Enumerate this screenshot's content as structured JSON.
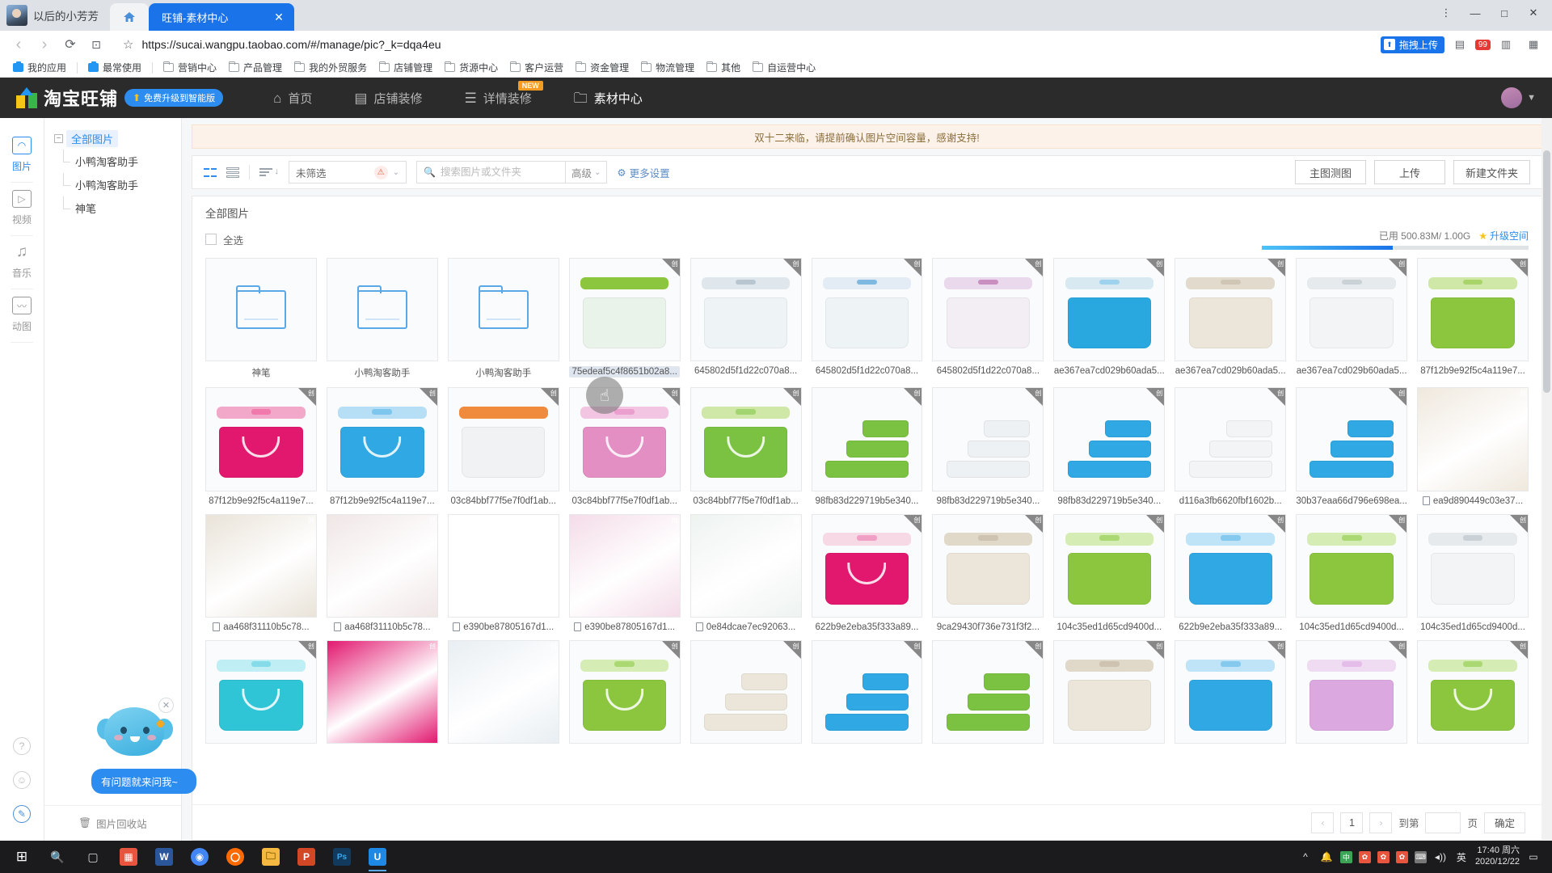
{
  "browser": {
    "profile_name": "以后的小芳芳",
    "tab_title": "旺铺-素材中心",
    "tab_close": "✕",
    "url": "https://sucai.wangpu.taobao.com/#/manage/pic?_k=dqa4eu",
    "nav": {
      "back": "‹",
      "forward": "›",
      "reload": "⟳",
      "cast": "⊡",
      "star": "☆"
    },
    "window": {
      "minimize": "—",
      "maximize": "□",
      "close": "✕",
      "menu": "⋮"
    },
    "ext_chip_label": "拖拽上传",
    "ext_badge": "99",
    "bookmarks": [
      {
        "label": "我的应用",
        "icon": "app-icon"
      },
      {
        "label": "最常使用",
        "icon": "app-icon"
      },
      {
        "label": "营销中心",
        "icon": "folder-icon"
      },
      {
        "label": "产品管理",
        "icon": "folder-icon"
      },
      {
        "label": "我的外贸服务",
        "icon": "folder-icon"
      },
      {
        "label": "店铺管理",
        "icon": "folder-icon"
      },
      {
        "label": "货源中心",
        "icon": "folder-icon"
      },
      {
        "label": "客户运营",
        "icon": "folder-icon"
      },
      {
        "label": "资金管理",
        "icon": "folder-icon"
      },
      {
        "label": "物流管理",
        "icon": "folder-icon"
      },
      {
        "label": "其他",
        "icon": "folder-icon"
      },
      {
        "label": "自运营中心",
        "icon": "folder-icon"
      }
    ]
  },
  "app_header": {
    "logo_text": "淘宝旺铺",
    "upgrade_pill": "免费升级到智能版",
    "nav": [
      {
        "label": "首页",
        "icon": "home-icon",
        "active": false,
        "badge": ""
      },
      {
        "label": "店铺装修",
        "icon": "shop-icon",
        "active": false,
        "badge": ""
      },
      {
        "label": "详情装修",
        "icon": "detail-icon",
        "active": false,
        "badge": "NEW"
      },
      {
        "label": "素材中心",
        "icon": "material-icon",
        "active": true,
        "badge": ""
      }
    ]
  },
  "rail": {
    "items": [
      {
        "label": "图片",
        "icon": "image-icon",
        "active": true
      },
      {
        "label": "视频",
        "icon": "video-icon",
        "active": false
      },
      {
        "label": "音乐",
        "icon": "music-icon",
        "active": false
      },
      {
        "label": "动图",
        "icon": "gif-icon",
        "active": false
      }
    ],
    "help": "?",
    "feedback": "☺",
    "edit": "✎"
  },
  "tree": {
    "toggle": "−",
    "root": "全部图片",
    "children": [
      "小鸭淘客助手",
      "小鸭淘客助手",
      "神笔"
    ],
    "recycle_bin": "图片回收站"
  },
  "notice": "双十二来临，请提前确认图片空间容量，感谢支持!",
  "toolbar": {
    "grid_view": "grid-view-icon",
    "list_view": "list-view-icon",
    "sort": "sort-icon",
    "filter_value": "未筛选",
    "search_placeholder": "搜索图片或文件夹",
    "search_value": "",
    "advanced": "高级",
    "more_settings": "更多设置",
    "btn_main_image": "主图测图",
    "btn_upload": "上传",
    "btn_new_folder": "新建文件夹"
  },
  "panel": {
    "title": "全部图片",
    "select_all": "全选",
    "storage_label": "已用",
    "storage_used": "500.83M",
    "storage_total": "1.00G",
    "storage_text": "已用 500.83M/ 1.00G",
    "storage_percent": 49,
    "upgrade_space": "升级空间"
  },
  "pagination": {
    "prev": "‹",
    "page": "1",
    "next": "›",
    "goto_label": "到第",
    "goto_value": "",
    "page_unit": "页",
    "confirm": "确定"
  },
  "assistant": {
    "bubble": "有问题就来问我~",
    "close": "✕"
  },
  "grid": {
    "corner_mark": "创",
    "items": [
      {
        "name": "神笔",
        "type": "folder"
      },
      {
        "name": "小鸭淘客助手",
        "type": "folder"
      },
      {
        "name": "小鸭淘客助手",
        "type": "folder"
      },
      {
        "name": "75edeaf5c4f8651b02a8...",
        "type": "image",
        "selected": true,
        "style": "box",
        "body": "#e9f3ea",
        "lid": "#8cc63f",
        "handle": "#8cc63f"
      },
      {
        "name": "645802d5f1d22c070a8...",
        "type": "image",
        "style": "box",
        "body": "#eef3f6",
        "lid": "#dfe7ec",
        "handle": "#b9c6cf"
      },
      {
        "name": "645802d5f1d22c070a8...",
        "type": "image",
        "style": "box",
        "body": "#eef3f6",
        "lid": "#e3ecf4",
        "handle": "#7fb8e0"
      },
      {
        "name": "645802d5f1d22c070a8...",
        "type": "image",
        "style": "box",
        "body": "#f3eef4",
        "lid": "#ead9ec",
        "handle": "#c98fc0"
      },
      {
        "name": "ae367ea7cd029b60ada5...",
        "type": "image",
        "style": "box",
        "body": "#29a8e0",
        "lid": "#d8e9f2",
        "handle": "#9fd2ec"
      },
      {
        "name": "ae367ea7cd029b60ada5...",
        "type": "image",
        "style": "box",
        "body": "#ece6da",
        "lid": "#e2dbcd",
        "handle": "#cfc6b5"
      },
      {
        "name": "ae367ea7cd029b60ada5...",
        "type": "image",
        "style": "box",
        "body": "#f2f4f5",
        "lid": "#e7eaec",
        "handle": "#cbd2d6"
      },
      {
        "name": "87f12b9e92f5c4a119e7...",
        "type": "image",
        "style": "box",
        "body": "#8cc63f",
        "lid": "#cfe8a8",
        "handle": "#a8d46a"
      },
      {
        "name": "87f12b9e92f5c4a119e7...",
        "type": "image",
        "style": "box",
        "body": "#e2186f",
        "lid": "#f2a8c8",
        "handle": "#ef7aab",
        "smile": true
      },
      {
        "name": "87f12b9e92f5c4a119e7...",
        "type": "image",
        "style": "box",
        "body": "#2fa8e4",
        "lid": "#b6dff5",
        "handle": "#7fc6ee",
        "smile": true
      },
      {
        "name": "03c84bbf77f5e7f0df1ab...",
        "type": "image",
        "style": "box",
        "body": "#f0f2f3",
        "lid": "#f08a3c",
        "handle": "#f08a3c"
      },
      {
        "name": "03c84bbf77f5e7f0df1ab...",
        "type": "image",
        "style": "box",
        "body": "#e48fc4",
        "lid": "#f2c6e2",
        "handle": "#ea9fce",
        "smile": true
      },
      {
        "name": "03c84bbf77f5e7f0df1ab...",
        "type": "image",
        "style": "box",
        "body": "#7cc242",
        "lid": "#cfe8a8",
        "handle": "#a2d470",
        "smile": true
      },
      {
        "name": "98fb83d229719b5e340...",
        "type": "image",
        "style": "stack",
        "body": "#7cc242"
      },
      {
        "name": "98fb83d229719b5e340...",
        "type": "image",
        "style": "stack",
        "body": "#eef1f3"
      },
      {
        "name": "98fb83d229719b5e340...",
        "type": "image",
        "style": "stack",
        "body": "#2fa8e4"
      },
      {
        "name": "d116a3fb6620fbf1602b...",
        "type": "image",
        "style": "stack",
        "body": "#f2f4f5"
      },
      {
        "name": "30b37eaa66d796e698ea...",
        "type": "image",
        "style": "stack",
        "body": "#2fa8e4"
      },
      {
        "name": "ea9d890449c03e37...",
        "type": "image",
        "style": "photo",
        "body": "#efe8dd",
        "doc": true
      },
      {
        "name": "aa468f31110b5c78...",
        "type": "image",
        "style": "photo",
        "body": "#e9e3d8",
        "doc": true
      },
      {
        "name": "aa468f31110b5c78...",
        "type": "image",
        "style": "photo",
        "body": "#f0e6e6",
        "doc": true
      },
      {
        "name": "e390be87805167d1...",
        "type": "image",
        "style": "doc",
        "body": "#ffffff",
        "doc": true
      },
      {
        "name": "e390be87805167d1...",
        "type": "image",
        "style": "photo",
        "body": "#f4dce8",
        "doc": true
      },
      {
        "name": "0e84dcae7ec92063...",
        "type": "image",
        "style": "photo",
        "body": "#eef3f0",
        "doc": true
      },
      {
        "name": "622b9e2eba35f333a89...",
        "type": "image",
        "style": "box",
        "body": "#e2186f",
        "lid": "#f7d9e6",
        "handle": "#f0a0c4",
        "smile": true
      },
      {
        "name": "9ca29430f736e731f3f2...",
        "type": "image",
        "style": "box",
        "body": "#ece6da",
        "lid": "#e0d8c9",
        "handle": "#cdc3b0"
      },
      {
        "name": "104c35ed1d65cd9400d...",
        "type": "image",
        "style": "box",
        "body": "#8cc63f",
        "lid": "#d6ecb5",
        "handle": "#aad873"
      },
      {
        "name": "622b9e2eba35f333a89...",
        "type": "image",
        "style": "box",
        "body": "#2fa8e4",
        "lid": "#bfe3f7",
        "handle": "#85c9ef"
      },
      {
        "name": "104c35ed1d65cd9400d...",
        "type": "image",
        "style": "box",
        "body": "#8cc63f",
        "lid": "#d6ecb5",
        "handle": "#aad873"
      },
      {
        "name": "104c35ed1d65cd9400d...",
        "type": "image",
        "style": "box",
        "body": "#f2f4f5",
        "lid": "#e7eaec",
        "handle": "#c9d1d6"
      },
      {
        "name": "",
        "type": "image",
        "style": "box",
        "body": "#2fc4d6",
        "lid": "#bfeef5",
        "handle": "#86dbe8",
        "smile": true
      },
      {
        "name": "",
        "type": "image",
        "style": "photo",
        "body": "#e2186f"
      },
      {
        "name": "",
        "type": "image",
        "style": "photo",
        "body": "#e8eef2"
      },
      {
        "name": "",
        "type": "image",
        "style": "box",
        "body": "#8cc63f",
        "lid": "#d6ecb5",
        "handle": "#aad873",
        "smile": true
      },
      {
        "name": "",
        "type": "image",
        "style": "stack",
        "body": "#ece6da"
      },
      {
        "name": "",
        "type": "image",
        "style": "stack",
        "body": "#2fa8e4"
      },
      {
        "name": "",
        "type": "image",
        "style": "stack",
        "body": "#7cc242"
      },
      {
        "name": "",
        "type": "image",
        "style": "box",
        "body": "#ece6da",
        "lid": "#e0d8c9",
        "handle": "#cdc3b0"
      },
      {
        "name": "",
        "type": "image",
        "style": "box",
        "body": "#2fa8e4",
        "lid": "#bfe3f7",
        "handle": "#85c9ef"
      },
      {
        "name": "",
        "type": "image",
        "style": "box",
        "body": "#dca8e0",
        "lid": "#f0dcf2",
        "handle": "#e4bde8"
      },
      {
        "name": "",
        "type": "image",
        "style": "box",
        "body": "#8cc63f",
        "lid": "#d6ecb5",
        "handle": "#aad873",
        "smile": true
      }
    ]
  },
  "taskbar": {
    "start": "⊞",
    "search": "○",
    "taskview": "▤",
    "apps": [
      {
        "name": "chart-app",
        "glyph": "⑂",
        "color": "#e8553e"
      },
      {
        "name": "word-app",
        "glyph": "W",
        "color": "#2b579a"
      },
      {
        "name": "chrome-app",
        "glyph": "◉",
        "color": "#4285f4"
      },
      {
        "name": "wangwang-app",
        "glyph": "〇",
        "color": "#ff6a00"
      },
      {
        "name": "explorer-app",
        "glyph": "🗀",
        "color": "#f5b942"
      },
      {
        "name": "ppt-app",
        "glyph": "P",
        "color": "#d24726"
      },
      {
        "name": "photoshop-app",
        "glyph": "Ps",
        "color": "#2e7fbb"
      },
      {
        "name": "browser-app",
        "glyph": "U",
        "color": "#1e88e5"
      }
    ],
    "tray": {
      "up": "^",
      "bell": "🔔",
      "ime_lang": "英",
      "ime_icons": [
        "中",
        "✿",
        "✿",
        "✿",
        "⌨"
      ],
      "volume": "◂))",
      "network": "▭",
      "time": "17:40 周六",
      "date": "2020/12/22",
      "notif": "▭"
    }
  }
}
